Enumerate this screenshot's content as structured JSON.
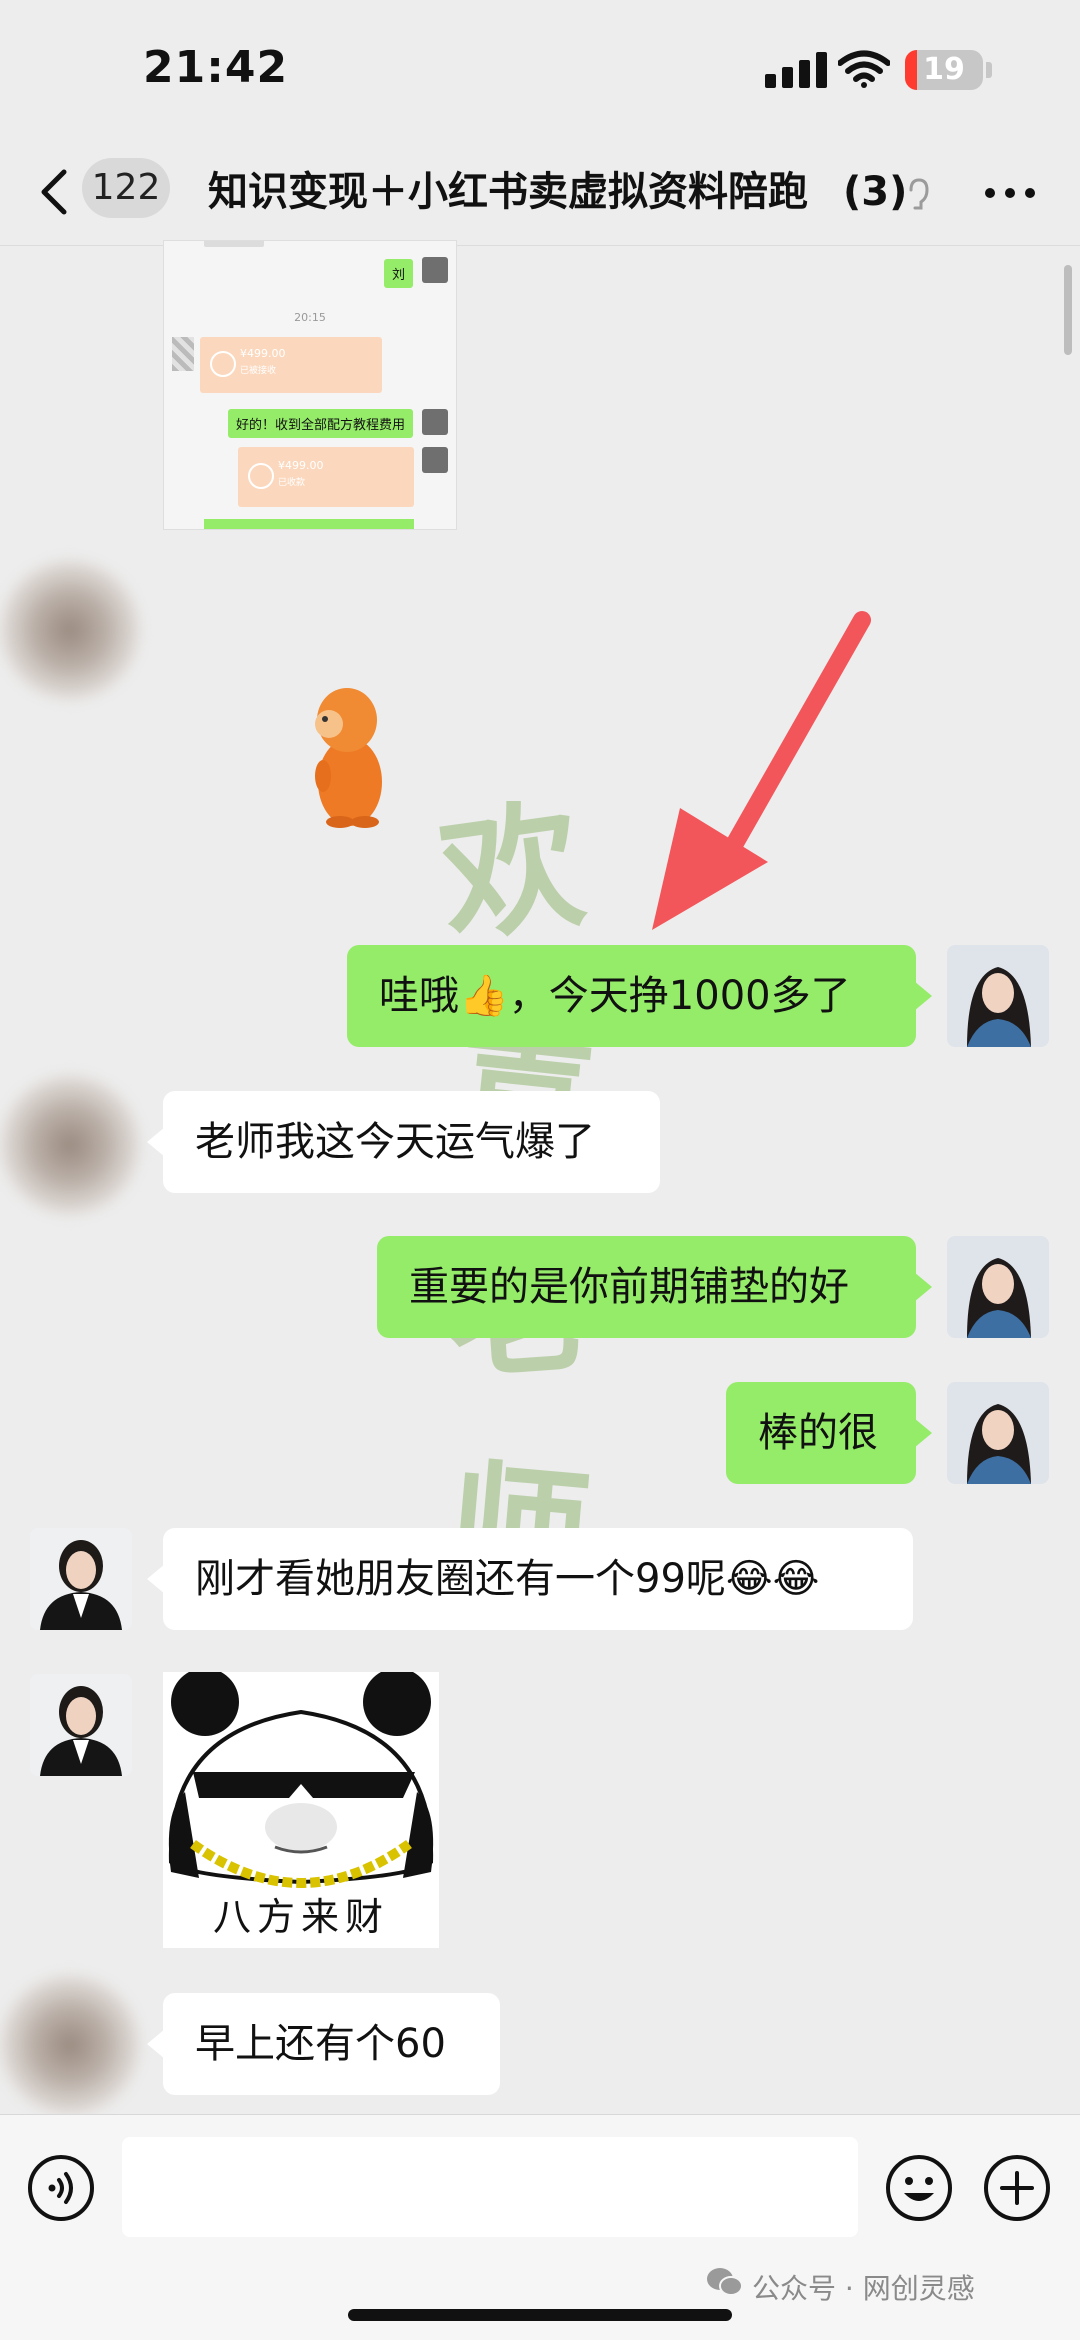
{
  "status_bar": {
    "time": "21:42",
    "battery": "19"
  },
  "header": {
    "back_count": "122",
    "title": "知识变现＋小红书卖虚拟资料陪跑",
    "member_count": "(3)"
  },
  "forwarded_screenshot": {
    "sender": "刘",
    "time": "20:15",
    "transfer_amount_1": "¥499.00",
    "transfer_note_1": "已被接收",
    "reply": "好的！收到全部配方教程费用",
    "transfer_amount_2": "¥499.00",
    "transfer_note_2": "已收款"
  },
  "messages": [
    {
      "side": "right",
      "text": "哇哦👍，今天挣1000多了"
    },
    {
      "side": "left",
      "text": "老师我这今天运气爆了"
    },
    {
      "side": "right",
      "text": "重要的是你前期铺垫的好"
    },
    {
      "side": "right",
      "text": "棒的很"
    },
    {
      "side": "left",
      "text": "刚才看她朋友圈还有一个99呢😂😂"
    },
    {
      "side": "left",
      "sticker_caption": "八方来财"
    },
    {
      "side": "left",
      "text": "早上还有个60"
    }
  ],
  "watermark": {
    "chars": [
      "欢",
      "喜",
      "老",
      "师"
    ]
  },
  "footer": {
    "source": "公众号 · 网创灵感"
  },
  "colors": {
    "bubble_green": "#95ec69",
    "bubble_white": "#ffffff",
    "background": "#ededed",
    "arrow": "#f2565a"
  }
}
